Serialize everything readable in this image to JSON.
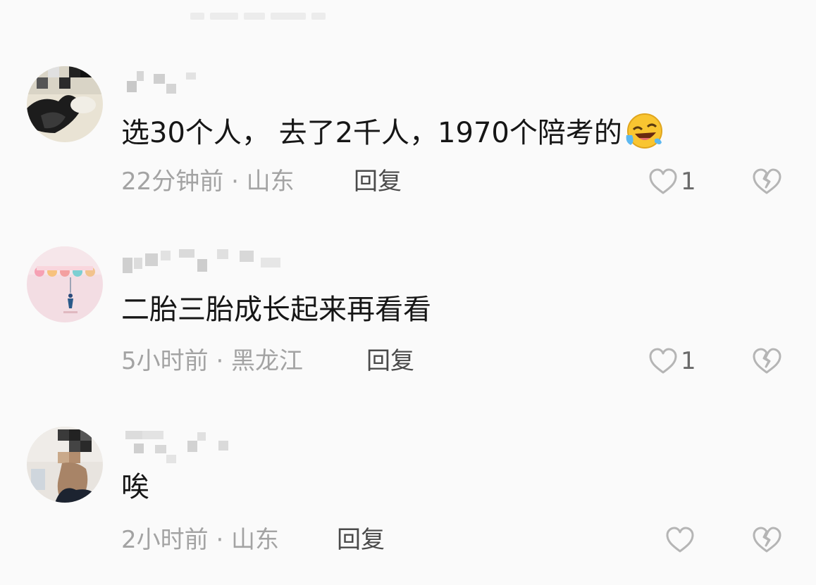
{
  "comments": [
    {
      "text": "选30个人， 去了2千人，1970个陪考的",
      "emoji": "laughing-crying-emoji",
      "meta": "22分钟前 · 山东",
      "reply_label": "回复",
      "likes": "1"
    },
    {
      "text": "二胎三胎成长起来再看看",
      "meta": "5小时前 · 黑龙江",
      "reply_label": "回复",
      "likes": "1"
    },
    {
      "text": "唉",
      "meta": "2小时前 · 山东",
      "reply_label": "回复",
      "likes": ""
    }
  ],
  "icons": {
    "like": "heart-outline-icon",
    "dislike": "broken-heart-icon"
  },
  "colors": {
    "background": "#fafafa",
    "text": "#161616",
    "meta": "#a3a3a3",
    "icon": "#b5b5b5"
  }
}
